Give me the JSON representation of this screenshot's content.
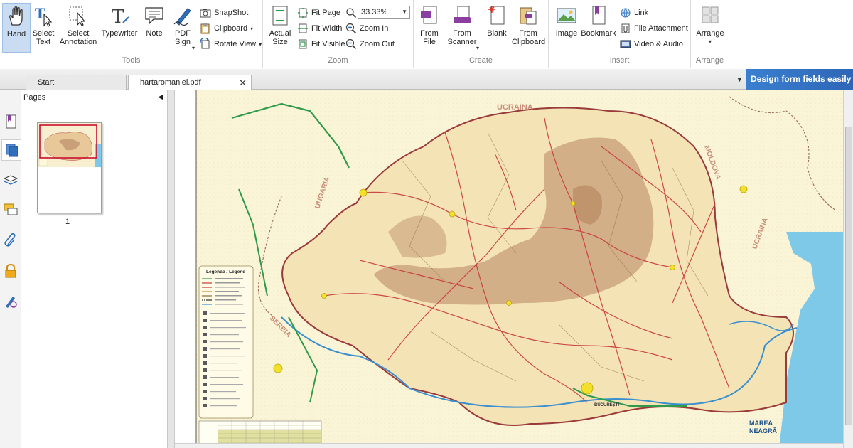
{
  "ribbon": {
    "tools": {
      "label": "Tools",
      "hand": "Hand",
      "select_text": "Select Text",
      "select_annotation": "Select Annotation",
      "typewriter": "Typewriter",
      "note": "Note",
      "pdf_sign": "PDF Sign",
      "snapshot": "SnapShot",
      "clipboard": "Clipboard",
      "rotate_view": "Rotate View"
    },
    "zoom": {
      "label": "Zoom",
      "actual_size": "Actual Size",
      "fit_page": "Fit Page",
      "fit_width": "Fit Width",
      "fit_visible": "Fit Visible",
      "zoom_level": "33.33%",
      "zoom_in": "Zoom In",
      "zoom_out": "Zoom Out"
    },
    "create": {
      "label": "Create",
      "from_file": "From File",
      "from_scanner": "From Scanner",
      "blank": "Blank",
      "from_clipboard": "From Clipboard"
    },
    "insert": {
      "label": "Insert",
      "image": "Image",
      "bookmark": "Bookmark",
      "link": "Link",
      "file_attachment": "File Attachment",
      "video_audio": "Video & Audio"
    },
    "arrange": {
      "label": "Arrange",
      "arrange": "Arrange"
    }
  },
  "tabs": [
    {
      "label": "Start"
    },
    {
      "label": "hartaromaniei.pdf"
    }
  ],
  "promo": "Design form fields easily",
  "pages_panel": {
    "title": "Pages",
    "thumb_number": "1"
  },
  "map": {
    "ukraine_top": "UCRAINA",
    "moldova": "MOLDOVA",
    "hungary": "UNGARIA",
    "serbia": "SERBIA",
    "ukraine_right": "UCRAINA",
    "sea_line1": "MAREA",
    "sea_line2": "NEAGRĂ",
    "legend_title": "Legenda / Legend",
    "capital": "BUCUREȘTI"
  },
  "colors": {
    "accent": "#c9dcf2",
    "promo": "#3a7fcf",
    "map_land": "#fbf5d8",
    "map_country": "#f3e3b5",
    "map_mountain": "#c9a07a",
    "sea": "#7ec9e8"
  }
}
